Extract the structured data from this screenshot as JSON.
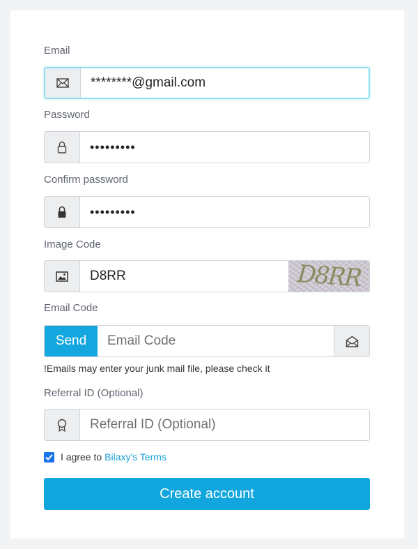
{
  "form": {
    "email": {
      "label": "Email",
      "value": "********@gmail.com",
      "icon": "envelope-icon"
    },
    "password": {
      "label": "Password",
      "value": "•••••••••",
      "icon": "lock-open-icon"
    },
    "confirm_password": {
      "label": "Confirm password",
      "value": "•••••••••",
      "icon": "lock-icon"
    },
    "image_code": {
      "label": "Image Code",
      "value": "D8RR",
      "captcha_text": "D8RR",
      "icon": "image-icon"
    },
    "email_code": {
      "label": "Email Code",
      "send_label": "Send",
      "placeholder": "Email Code",
      "icon": "open-envelope-icon"
    },
    "hint": "!Emails may enter your junk mail file, please check it",
    "referral": {
      "label": "Referral ID (Optional)",
      "placeholder": "Referral ID (Optional)",
      "icon": "badge-icon"
    },
    "agree": {
      "text": "I agree to",
      "link": "Bilaxy's Terms",
      "checked": true
    },
    "submit_label": "Create account"
  },
  "colors": {
    "accent": "#12a6df",
    "link": "#1aa0d8",
    "focus_border": "#8fe0f2",
    "checkbox": "#1a73e8"
  }
}
